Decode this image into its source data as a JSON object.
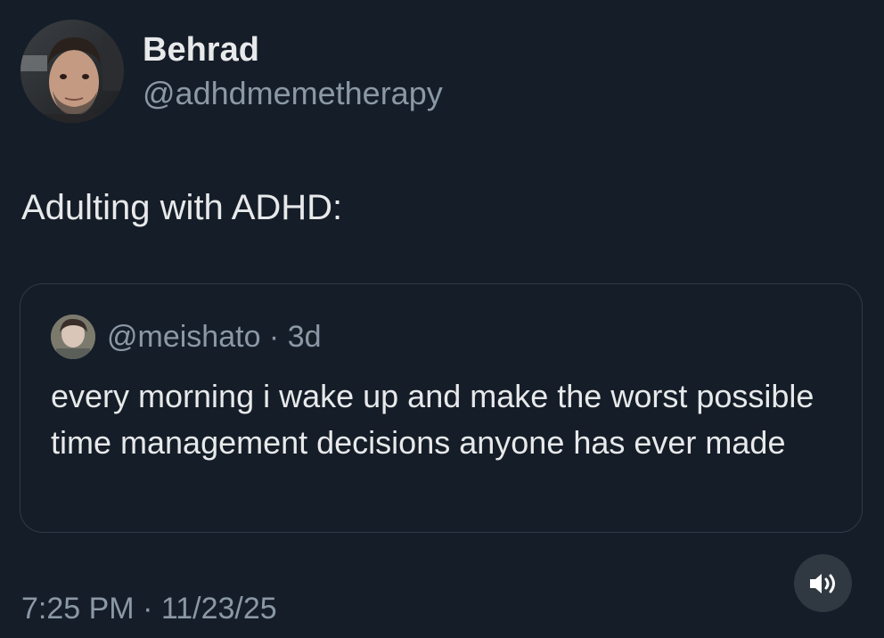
{
  "author": {
    "display_name": "Behrad",
    "handle": "@adhdmemetherapy"
  },
  "tweet": {
    "text": "Adulting with ADHD:",
    "timestamp": "7:25 PM · 11/23/25"
  },
  "quoted_tweet": {
    "meta": "@meishato · 3d",
    "text": "every morning i wake up and make the worst possible time management decisions anyone has ever made"
  },
  "media_controls": {
    "sound_icon": "speaker-volume-icon"
  },
  "colors": {
    "background": "#151d28",
    "primary_text": "#e7e9ea",
    "secondary_text": "#8b98a5",
    "card_border": "#2f3b47",
    "button_bg": "#303942"
  }
}
